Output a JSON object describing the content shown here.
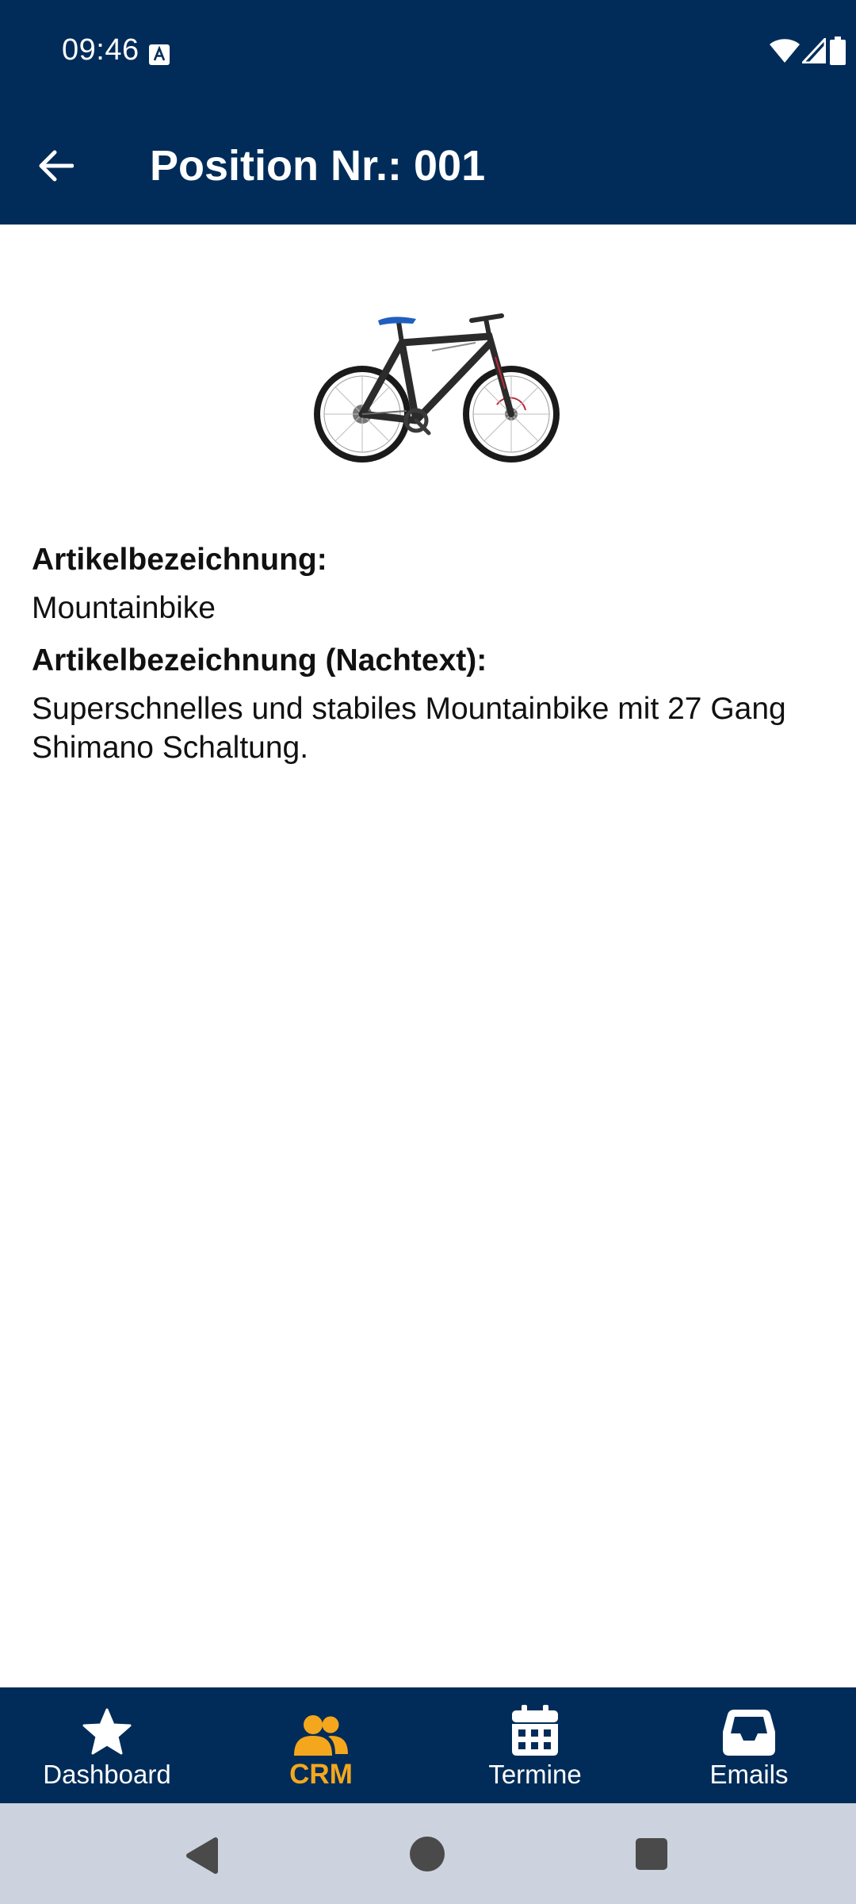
{
  "status_bar": {
    "time": "09:46",
    "icons": [
      "text-a-icon",
      "wifi-icon",
      "signal-icon",
      "battery-icon"
    ]
  },
  "app_bar": {
    "title": "Position Nr.: 001",
    "back_icon": "arrow-left-icon"
  },
  "product": {
    "image": "mountainbike-image"
  },
  "details": {
    "label_name": "Artikelbezeichnung:",
    "value_name": "Mountainbike",
    "label_text": "Artikelbezeichnung (Nachtext):",
    "value_text": "Superschnelles und stabiles Mountainbike mit 27 Gang Shimano Schaltung."
  },
  "bottom_nav": {
    "items": [
      {
        "label": "Dashboard",
        "icon": "star-icon",
        "active": false
      },
      {
        "label": "CRM",
        "icon": "people-icon",
        "active": true
      },
      {
        "label": "Termine",
        "icon": "calendar-icon",
        "active": false
      },
      {
        "label": "Emails",
        "icon": "inbox-icon",
        "active": false
      }
    ]
  },
  "colors": {
    "primary": "#012c59",
    "accent": "#f4a71d",
    "system_nav": "#ccd3de"
  }
}
